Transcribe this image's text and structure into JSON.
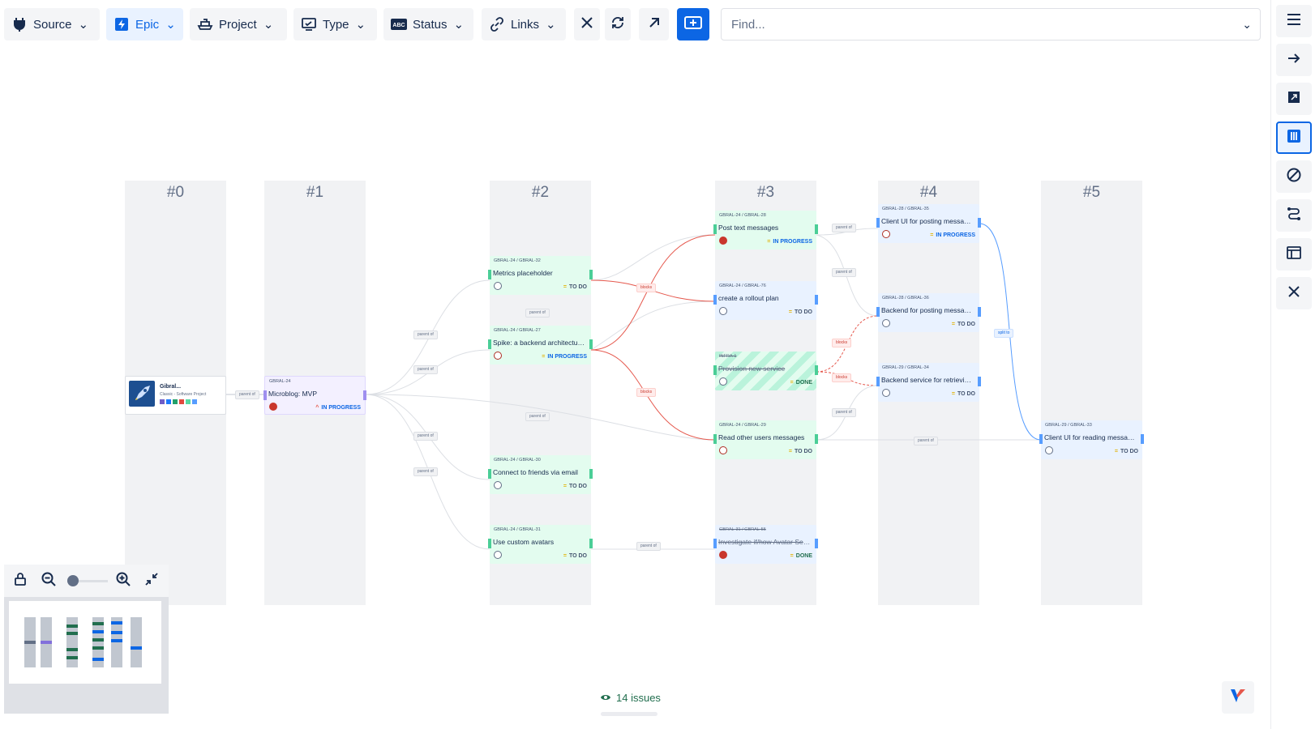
{
  "toolbar": {
    "source": "Source",
    "epic": "Epic",
    "project": "Project",
    "type": "Type",
    "status": "Status",
    "links": "Links",
    "find_placeholder": "Find..."
  },
  "columns": [
    "#0",
    "#1",
    "#2",
    "#3",
    "#4",
    "#5"
  ],
  "project_card": {
    "name": "Gibral...",
    "subtitle": "Classic - Software Project"
  },
  "cards": {
    "c1": {
      "keys": "GBRAL-24",
      "summary": "Microblog: MVP",
      "status": "IN PROGRESS"
    },
    "c2a": {
      "keys": "GBRAL-24 / GBRAL-32",
      "summary": "Metrics placeholder",
      "status": "TO DO"
    },
    "c2b": {
      "keys": "GBRAL-24 / GBRAL-27",
      "summary": "Spike: a backend architecture f...",
      "status": "IN PROGRESS"
    },
    "c2c": {
      "keys": "GBRAL-24 / GBRAL-30",
      "summary": "Connect to friends via email",
      "status": "TO DO"
    },
    "c2d": {
      "keys": "GBRAL-24 / GBRAL-31",
      "summary": "Use custom avatars",
      "status": "TO DO"
    },
    "c3a": {
      "keys": "GBRAL-24 / GBRAL-28",
      "summary": "Post text messages",
      "status": "IN PROGRESS"
    },
    "c3b": {
      "keys": "GBRAL-24 / GBRAL-76",
      "summary": "create a rollout plan",
      "status": "TO DO"
    },
    "c3c": {
      "keys": "INFRA-1",
      "summary": "Provision new service",
      "status": "DONE"
    },
    "c3d": {
      "keys": "GBRAL-24 / GBRAL-29",
      "summary": "Read other users messages",
      "status": "TO DO"
    },
    "c3e": {
      "keys": "GBRAL-31 / GBRAL-55",
      "summary": "Investigate if/how Avatar Servi...",
      "status": "DONE"
    },
    "c4a": {
      "keys": "GBRAL-28 / GBRAL-35",
      "summary": "Client UI for posting messages",
      "status": "IN PROGRESS"
    },
    "c4b": {
      "keys": "GBRAL-28 / GBRAL-36",
      "summary": "Backend for posting messages",
      "status": "TO DO"
    },
    "c4c": {
      "keys": "GBRAL-29 / GBRAL-34",
      "summary": "Backend service for retrieving...",
      "status": "TO DO"
    },
    "c5a": {
      "keys": "GBRAL-29 / GBRAL-33",
      "summary": "Client UI for reading messages",
      "status": "TO DO"
    }
  },
  "link_labels": {
    "parent_of": "parent of",
    "blocks": "blocks",
    "split_to": "split to"
  },
  "footer": {
    "issues": "14 issues"
  },
  "colors": {
    "accent": "#0c66e4",
    "todo": "#e3fcef",
    "progress": "#e9f2ff",
    "epic": "#f3f0ff",
    "blocks_line": "#e5574c",
    "split_line": "#579dff"
  }
}
